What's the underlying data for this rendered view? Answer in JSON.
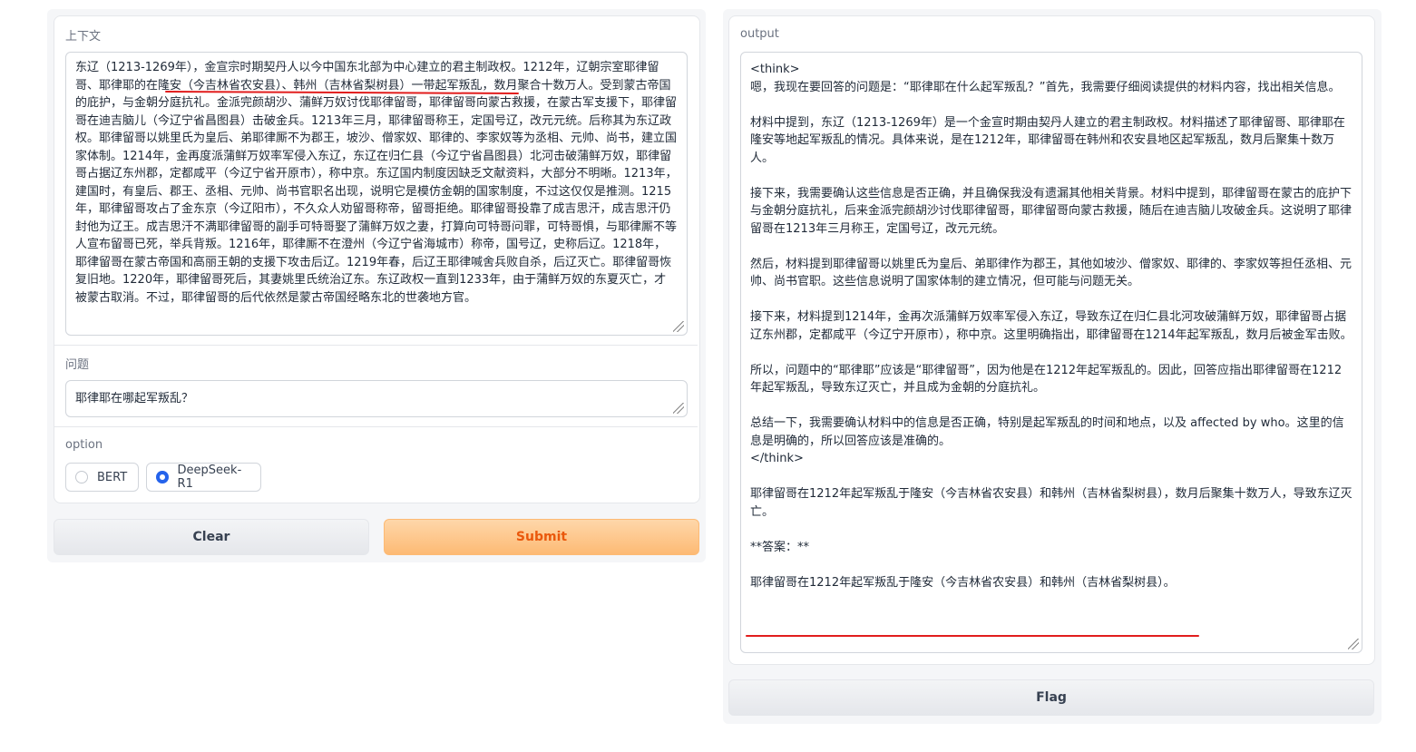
{
  "left": {
    "context": {
      "label": "上下文",
      "value": "东辽（1213-1269年），金宣宗时期契丹人以今中国东北部为中心建立的君主制政权。1212年，辽朝宗室耶律留哥、耶律耶的在隆安（今吉林省农安县）、韩州（吉林省梨树县）一带起军叛乱，数月聚合十数万人。受到蒙古帝国的庇护，与金朝分庭抗礼。金派完颜胡沙、蒲鲜万奴讨伐耶律留哥，耶律留哥向蒙古救援，在蒙古军支援下，耶律留哥在迪吉脑儿（今辽宁省昌图县）击破金兵。1213年三月，耶律留哥称王，定国号辽，改元元统。后称其为东辽政权。耶律留哥以姚里氏为皇后、弟耶律厮不为郡王，坡沙、僧家奴、耶律的、李家奴等为丞相、元帅、尚书，建立国家体制。1214年，金再度派蒲鲜万奴率军侵入东辽，东辽在归仁县（今辽宁省昌图县）北河击破蒲鲜万奴，耶律留哥占据辽东州郡，定都咸平（今辽宁省开原市），称中京。东辽国内制度因缺乏文献资料，大部分不明晰。1213年，建国时，有皇后、郡王、丞相、元帅、尚书官职名出现，说明它是模仿金朝的国家制度，不过这仅仅是推测。1215年，耶律留哥攻占了金东京（今辽阳市），不久众人劝留哥称帝，留哥拒绝。耶律留哥投靠了成吉思汗，成吉思汗仍封他为辽王。成吉思汗不满耶律留哥的副手可特哥娶了蒲鲜万奴之妻，打算向可特哥问罪，可特哥惧，与耶律厮不等人宣布留哥已死，举兵背叛。1216年，耶律厮不在澄州（今辽宁省海城市）称帝，国号辽，史称后辽。1218年，耶律留哥在蒙古帝国和高丽王朝的支援下攻击后辽。1219年春，后辽王耶律喊舍兵败自杀，后辽灭亡。耶律留哥恢复旧地。1220年，耶律留哥死后，其妻姚里氏统治辽东。东辽政权一直到1233年，由于蒲鲜万奴的东夏灭亡，才被蒙古取消。不过，耶律留哥的后代依然是蒙古帝国经略东北的世袭地方官。"
    },
    "question": {
      "label": "问题",
      "value": "耶律耶在哪起军叛乱？"
    },
    "option": {
      "label": "option",
      "choices": [
        "BERT",
        "DeepSeek-R1"
      ],
      "selected": "DeepSeek-R1"
    },
    "buttons": {
      "clear": "Clear",
      "submit": "Submit"
    }
  },
  "right": {
    "output": {
      "label": "output",
      "value": "<think>\n嗯，我现在要回答的问题是：“耶律耶在什么起军叛乱？”首先，我需要仔细阅读提供的材料内容，找出相关信息。\n\n材料中提到，东辽（1213-1269年）是一个金宣时期由契丹人建立的君主制政权。材料描述了耶律留哥、耶律耶在隆安等地起军叛乱的情况。具体来说，是在1212年，耶律留哥在韩州和农安县地区起军叛乱，数月后聚集十数万人。\n\n接下来，我需要确认这些信息是否正确，并且确保我没有遗漏其他相关背景。材料中提到，耶律留哥在蒙古的庇护下与金朝分庭抗礼，后来金派完颜胡沙讨伐耶律留哥，耶律留哥向蒙古救援，随后在迪吉脑儿攻破金兵。这说明了耶律留哥在1213年三月称王，定国号辽，改元元统。\n\n然后，材料提到耶律留哥以姚里氏为皇后、弟耶律作为郡王，其他如坡沙、僧家奴、耶律的、李家奴等担任丞相、元帅、尚书官职。这些信息说明了国家体制的建立情况，但可能与问题无关。\n\n接下来，材料提到1214年，金再次派蒲鲜万奴率军侵入东辽，导致东辽在归仁县北河攻破蒲鲜万奴，耶律留哥占据辽东州郡，定都咸平（今辽宁开原市），称中京。这里明确指出，耶律留哥在1214年起军叛乱，数月后被金军击败。\n\n所以，问题中的“耶律耶”应该是“耶律留哥”，因为他是在1212年起军叛乱的。因此，回答应指出耶律留哥在1212年起军叛乱，导致东辽灭亡，并且成为金朝的分庭抗礼。\n\n总结一下，我需要确认材料中的信息是否正确，特别是起军叛乱的时间和地点，以及 affected by who。这里的信息是明确的，所以回答应该是准确的。\n</think>\n\n耶律留哥在1212年起军叛乱于隆安（今吉林省农安县）和韩州（吉林省梨树县），数月后聚集十数万人，导致东辽灭亡。\n\n**答案：**\n\n耶律留哥在1212年起军叛乱于隆安（今吉林省农安县）和韩州（吉林省梨树县）。"
    },
    "buttons": {
      "flag": "Flag"
    }
  },
  "colors": {
    "primary_button": "#fdba74",
    "primary_text": "#ea580c",
    "radio_selected": "#2563eb",
    "annotation_line": "#e11d1d"
  }
}
